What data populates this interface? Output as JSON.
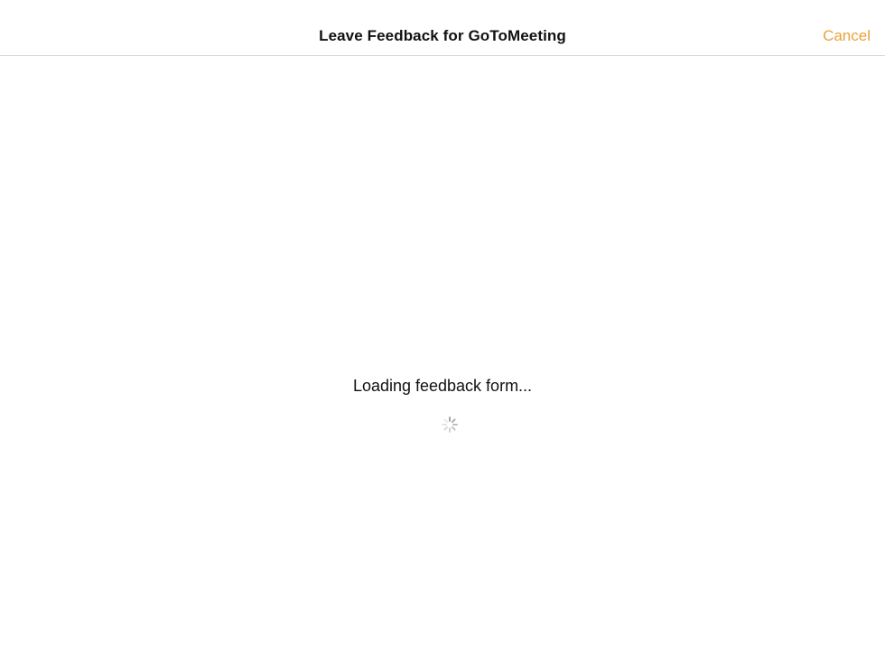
{
  "nav": {
    "title": "Leave Feedback for GoToMeeting",
    "cancel_label": "Cancel"
  },
  "content": {
    "loading_message": "Loading feedback form...",
    "spinner_icon": "activity-spinner-icon"
  },
  "colors": {
    "accent": "#e8a23a",
    "divider": "#d9d9d9",
    "text": "#111111"
  }
}
